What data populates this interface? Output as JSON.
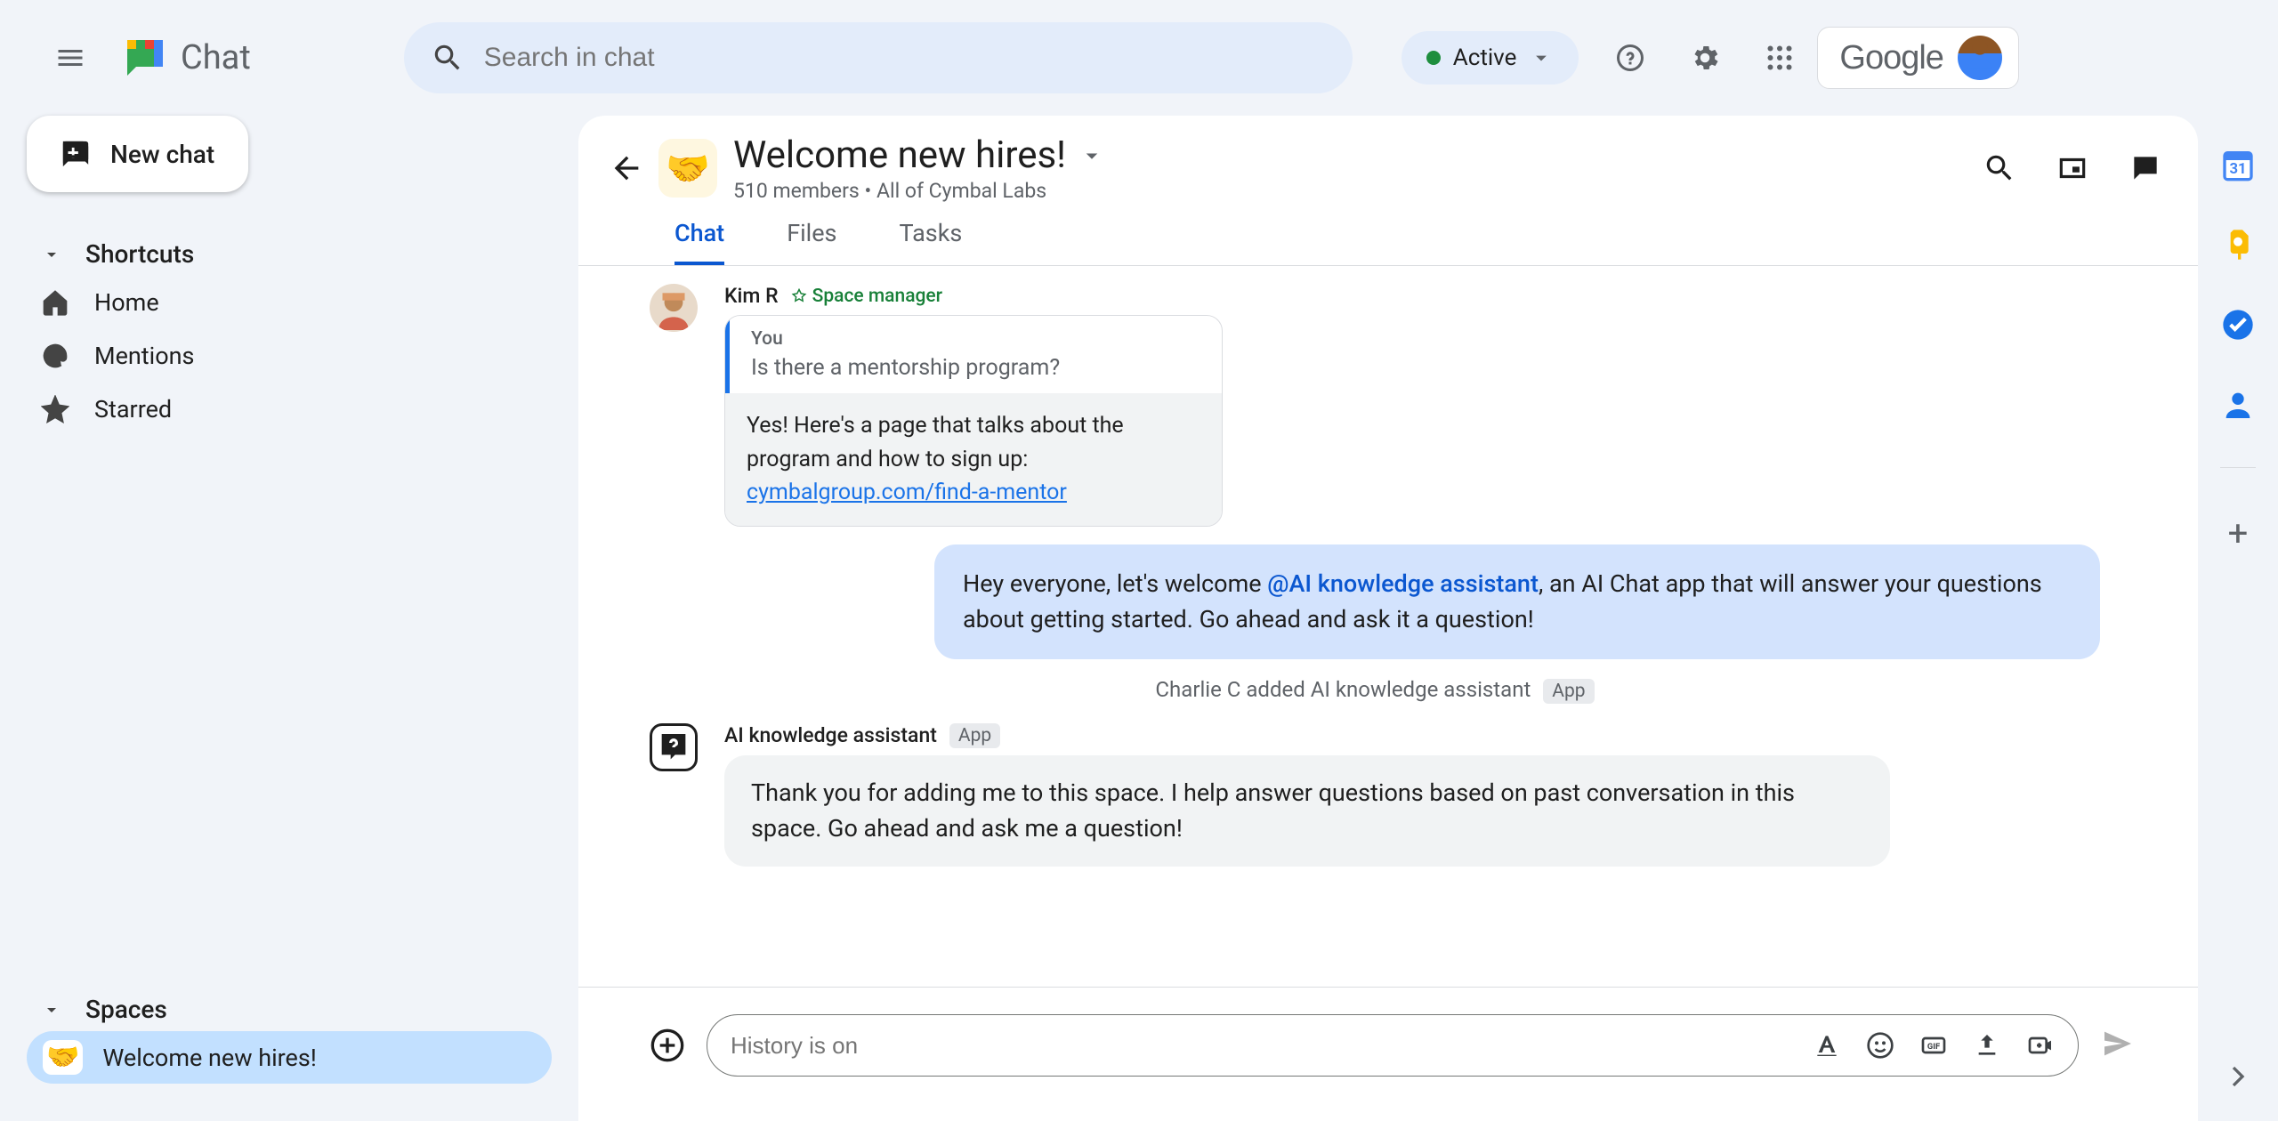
{
  "header": {
    "app_name": "Chat",
    "search_placeholder": "Search in chat",
    "status_label": "Active",
    "brand": "Google"
  },
  "sidebar": {
    "new_chat": "New chat",
    "shortcuts_label": "Shortcuts",
    "home": "Home",
    "mentions": "Mentions",
    "starred": "Starred",
    "spaces_label": "Spaces",
    "active_space": "Welcome new hires!"
  },
  "room": {
    "title": "Welcome new hires!",
    "subtitle": "510 members  •  All of Cymbal Labs",
    "tabs": {
      "chat": "Chat",
      "files": "Files",
      "tasks": "Tasks"
    }
  },
  "messages": {
    "kim": {
      "name": "Kim R",
      "badge": "Space manager",
      "quote_you": "You",
      "quote_q": "Is there a mentorship program?",
      "answer_1": "Yes! Here's a page that talks about the program and how to sign up:",
      "answer_link": "cymbalgroup.com/find-a-mentor"
    },
    "blue": {
      "prefix": "Hey everyone, let's welcome ",
      "mention": "@AI knowledge assistant",
      "suffix": ", an AI Chat app that will answer your questions about getting started.  Go ahead and ask it a question!"
    },
    "system": {
      "text": "Charlie C added AI knowledge assistant",
      "badge": "App"
    },
    "ai": {
      "name": "AI knowledge assistant",
      "badge": "App",
      "body": "Thank you for adding me to this space. I help answer questions based on past conversation in this space. Go ahead and ask me a question!"
    }
  },
  "composer": {
    "placeholder": "History is on"
  }
}
